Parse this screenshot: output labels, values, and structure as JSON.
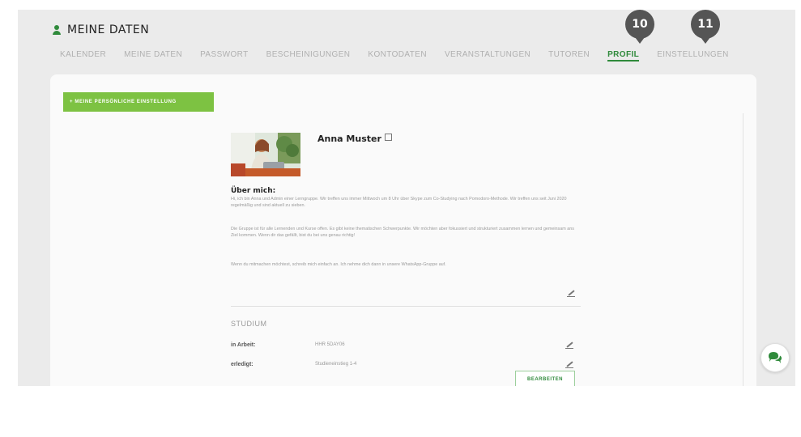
{
  "header": {
    "title": "MEINE DATEN",
    "icon": "user-icon"
  },
  "tabs": [
    {
      "label": "KALENDER",
      "active": false
    },
    {
      "label": "MEINE DATEN",
      "active": false
    },
    {
      "label": "PASSWORT",
      "active": false
    },
    {
      "label": "BESCHEINIGUNGEN",
      "active": false
    },
    {
      "label": "KONTODATEN",
      "active": false
    },
    {
      "label": "VERANSTALTUNGEN",
      "active": false
    },
    {
      "label": "TUTOREN",
      "active": false
    },
    {
      "label": "PROFIL",
      "active": true
    },
    {
      "label": "EINSTELLUNGEN",
      "active": false
    }
  ],
  "markers": [
    {
      "number": "10"
    },
    {
      "number": "11"
    }
  ],
  "settings_button": {
    "label": "+ MEINE PERSÖNLICHE EINSTELLUNG"
  },
  "profile": {
    "name": "Anna Muster",
    "about_title": "Über mich:",
    "about_paragraphs": [
      "Hi, ich bin Anna und Admin einer Lerngruppe. Wir treffen uns immer Mittwoch um 8 Uhr über Skype zum Co-Studying nach Pomodoro-Methode. Wir treffen uns seit Juni 2020 regelmäßig und sind aktuell zu sieben.",
      "Die Gruppe ist für alle Lernenden und Kurse offen. Es gibt keine thematischen Schwerpunkte. Wir möchten aber fokussiert und strukturiert zusammen lernen und gemeinsam ans Ziel kommen. Wenn dir das gefällt, bist du bei uns genau richtig!",
      "Wenn du mitmachen möchtest, schreib mich einfach an. Ich nehme dich dann in unsere WhatsApp-Gruppe auf."
    ]
  },
  "studium": {
    "section_title": "STUDIUM",
    "rows": [
      {
        "label": "in Arbeit:",
        "value": "HHR 5DAY06"
      },
      {
        "label": "erledigt:",
        "value": "Studieneinstieg 1-4"
      }
    ],
    "edit_button_label": "BEARBEITEN"
  },
  "colors": {
    "brand_green": "#2f8a3b",
    "button_green": "#7dc242",
    "marker_gray": "#555555"
  }
}
